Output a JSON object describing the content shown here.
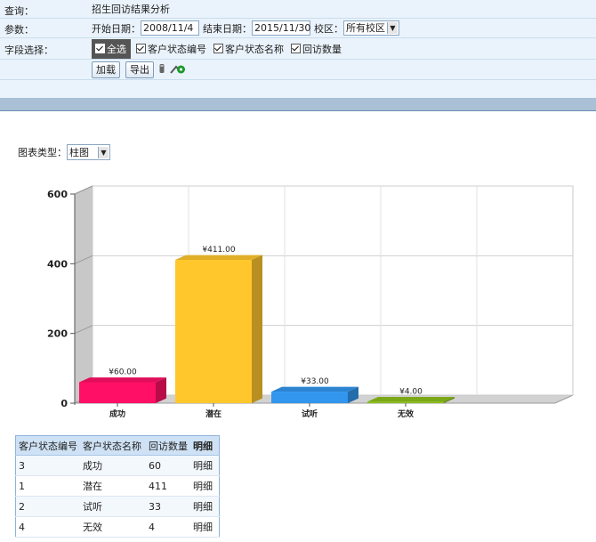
{
  "query": {
    "label": "查询：",
    "value": "招生回访结果分析"
  },
  "params": {
    "label": "参数：",
    "start_label": "开始日期：",
    "start_date": "2008/11/4",
    "end_label": "结束日期：",
    "end_date": "2015/11/30",
    "campus_label": "校区：",
    "campus_value": "所有校区"
  },
  "fields": {
    "label": "字段选择：",
    "select_all": "全选",
    "items": [
      "客户状态编号",
      "客户状态名称",
      "回访数量"
    ]
  },
  "actions": {
    "load": "加载",
    "export": "导出"
  },
  "chart_type": {
    "label": "图表类型：",
    "value": "柱图"
  },
  "chart_data": {
    "type": "bar",
    "categories": [
      "成功",
      "潜在",
      "试听",
      "无效"
    ],
    "values": [
      60,
      411,
      33,
      4
    ],
    "value_labels": [
      "¥60.00",
      "¥411.00",
      "¥33.00",
      "¥4.00"
    ],
    "colors": [
      "#ff1066",
      "#ffc72c",
      "#3296ee",
      "#8cbf1a"
    ],
    "ylim": [
      0,
      600
    ],
    "yticks": [
      "0",
      "200",
      "400",
      "600"
    ],
    "grid": true
  },
  "table": {
    "headers": [
      "客户状态编号",
      "客户状态名称",
      "回访数量",
      "明细"
    ],
    "rows": [
      [
        "3",
        "成功",
        "60",
        "明细"
      ],
      [
        "1",
        "潜在",
        "411",
        "明细"
      ],
      [
        "2",
        "试听",
        "33",
        "明细"
      ],
      [
        "4",
        "无效",
        "4",
        "明细"
      ]
    ]
  }
}
